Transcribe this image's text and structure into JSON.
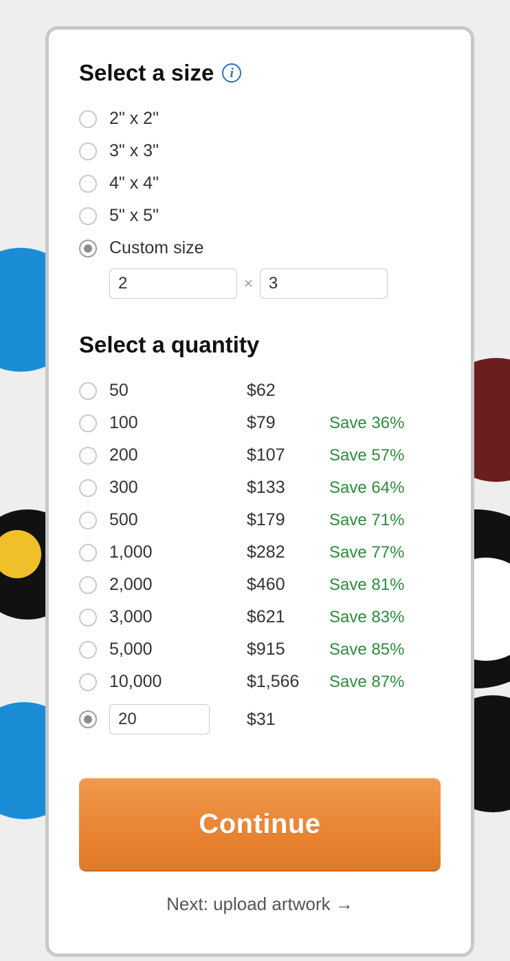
{
  "size": {
    "title": "Select a size",
    "options": [
      {
        "label": "2\" x 2\"",
        "selected": false
      },
      {
        "label": "3\" x 3\"",
        "selected": false
      },
      {
        "label": "4\" x 4\"",
        "selected": false
      },
      {
        "label": "5\" x 5\"",
        "selected": false
      },
      {
        "label": "Custom size",
        "selected": true
      }
    ],
    "custom": {
      "width": "2",
      "height": "3",
      "separator": "×"
    }
  },
  "quantity": {
    "title": "Select a quantity",
    "options": [
      {
        "qty": "50",
        "price": "$62",
        "save": ""
      },
      {
        "qty": "100",
        "price": "$79",
        "save": "Save 36%"
      },
      {
        "qty": "200",
        "price": "$107",
        "save": "Save 57%"
      },
      {
        "qty": "300",
        "price": "$133",
        "save": "Save 64%"
      },
      {
        "qty": "500",
        "price": "$179",
        "save": "Save 71%"
      },
      {
        "qty": "1,000",
        "price": "$282",
        "save": "Save 77%"
      },
      {
        "qty": "2,000",
        "price": "$460",
        "save": "Save 81%"
      },
      {
        "qty": "3,000",
        "price": "$621",
        "save": "Save 83%"
      },
      {
        "qty": "5,000",
        "price": "$915",
        "save": "Save 85%"
      },
      {
        "qty": "10,000",
        "price": "$1,566",
        "save": "Save 87%"
      }
    ],
    "custom": {
      "value": "20",
      "price": "$31",
      "selected": true
    }
  },
  "continue_label": "Continue",
  "next_step": "Next: upload artwork →",
  "info_glyph": "i"
}
